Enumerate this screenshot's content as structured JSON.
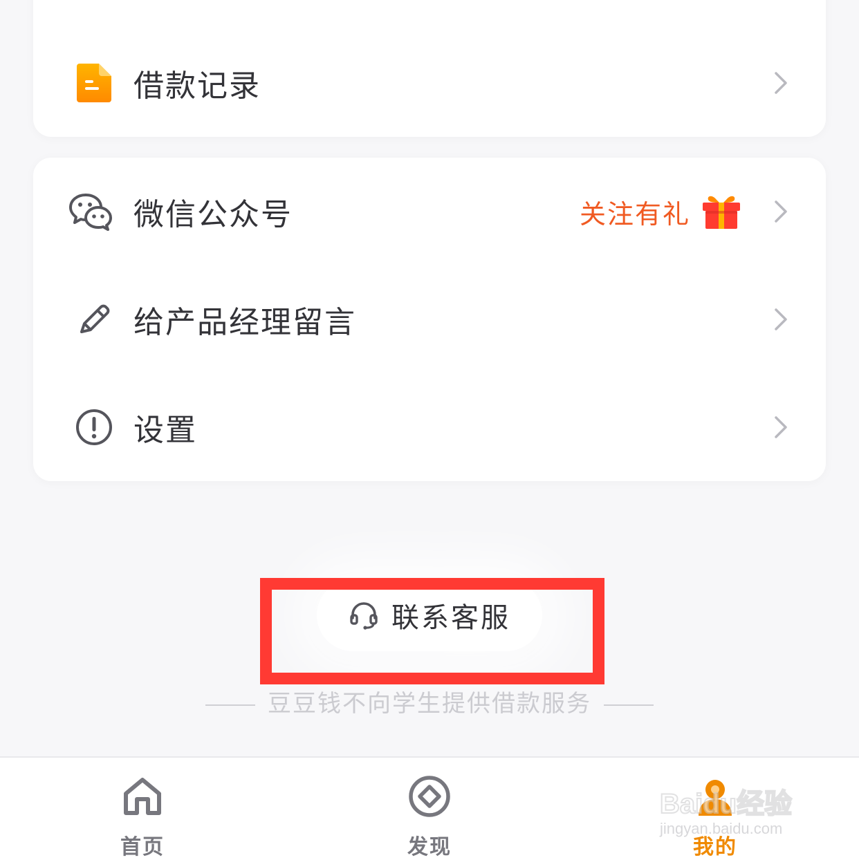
{
  "menu_top": {
    "items": [
      {
        "label": "借款记录",
        "icon": "document-icon"
      }
    ]
  },
  "menu_main": {
    "items": [
      {
        "label": "微信公众号",
        "icon": "wechat-icon",
        "extra": "关注有礼",
        "extra_icon": "gift-icon"
      },
      {
        "label": "给产品经理留言",
        "icon": "pencil-icon"
      },
      {
        "label": "设置",
        "icon": "info-circle-icon"
      }
    ]
  },
  "support": {
    "label": "联系客服",
    "icon": "headset-icon"
  },
  "notice": "豆豆钱不向学生提供借款服务",
  "tabbar": {
    "tabs": [
      {
        "label": "首页",
        "icon": "home-icon",
        "active": false
      },
      {
        "label": "发现",
        "icon": "compass-icon",
        "active": false
      },
      {
        "label": "我的",
        "icon": "user-icon",
        "active": true
      }
    ]
  },
  "watermark": {
    "brand": "Baidu经验",
    "url": "jingyan.baidu.com"
  },
  "colors": {
    "accent": "#f08a00",
    "promo": "#f05a22",
    "highlight_box": "#ff3a33",
    "text": "#333338",
    "muted": "#cbcbd0"
  }
}
